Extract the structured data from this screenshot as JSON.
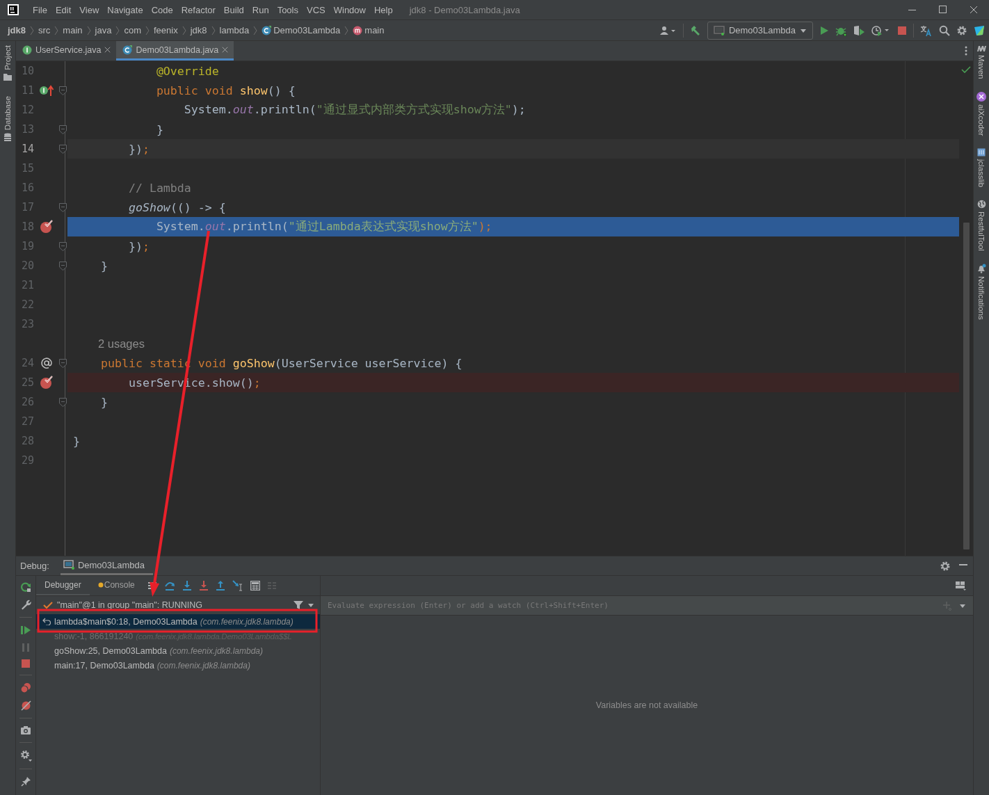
{
  "window": {
    "title": "jdk8 - Demo03Lambda.java"
  },
  "menu": [
    "File",
    "Edit",
    "View",
    "Navigate",
    "Code",
    "Refactor",
    "Build",
    "Run",
    "Tools",
    "VCS",
    "Window",
    "Help"
  ],
  "breadcrumbs": [
    {
      "label": "jdk8",
      "kind": "project"
    },
    {
      "label": "src",
      "kind": "folder"
    },
    {
      "label": "main",
      "kind": "folder"
    },
    {
      "label": "java",
      "kind": "folder"
    },
    {
      "label": "com",
      "kind": "folder"
    },
    {
      "label": "feenix",
      "kind": "folder"
    },
    {
      "label": "jdk8",
      "kind": "folder"
    },
    {
      "label": "lambda",
      "kind": "folder"
    },
    {
      "label": "Demo03Lambda",
      "kind": "class"
    },
    {
      "label": "main",
      "kind": "method"
    }
  ],
  "run_config": {
    "label": "Demo03Lambda"
  },
  "editor_tabs": [
    {
      "label": "UserService.java",
      "kind": "interface",
      "selected": false
    },
    {
      "label": "Demo03Lambda.java",
      "kind": "class",
      "selected": true
    }
  ],
  "left_tool_windows": [
    "Project",
    "Database"
  ],
  "right_tool_windows": [
    "Maven",
    "aiXcoder",
    "jclasslib",
    "RestfulTool",
    "Notifications"
  ],
  "code_lines": [
    {
      "kind": "code",
      "number": "10",
      "tokens": [
        {
          "t": "            @Override",
          "kind": "annotation"
        }
      ]
    },
    {
      "kind": "code",
      "number": "11",
      "marker": {
        "kind": "implements"
      },
      "fold": true,
      "tokens": [
        {
          "t": "            public void ",
          "kind": "keyword"
        },
        {
          "t": "show",
          "kind": "decl"
        },
        {
          "t": "() {",
          "kind": "plain"
        }
      ]
    },
    {
      "kind": "code",
      "number": "12",
      "tokens": [
        {
          "t": "                System.",
          "kind": "plain"
        },
        {
          "t": "out",
          "kind": "field"
        },
        {
          "t": ".println(",
          "kind": "plain"
        },
        {
          "t": "\"通过显式内部类方式实现show方法\"",
          "kind": "string"
        },
        {
          "t": ");",
          "kind": "plain"
        }
      ]
    },
    {
      "kind": "code",
      "number": "13",
      "fold": true,
      "tokens": [
        {
          "t": "            }",
          "kind": "plain"
        }
      ]
    },
    {
      "kind": "code",
      "number": "14",
      "fold": true,
      "highlight": {
        "kind": "caret"
      },
      "tokens": [
        {
          "t": "        })",
          "kind": "plain"
        },
        {
          "t": ";",
          "kind": "keyword"
        }
      ]
    },
    {
      "kind": "code",
      "number": "15"
    },
    {
      "kind": "code",
      "number": "16",
      "tokens": [
        {
          "t": "        // Lambda",
          "kind": "comment"
        }
      ]
    },
    {
      "kind": "code",
      "number": "17",
      "fold": true,
      "tokens": [
        {
          "t": "        goShow",
          "kind": "call"
        },
        {
          "t": "(() -> {",
          "kind": "plain"
        }
      ]
    },
    {
      "kind": "code",
      "number": "18",
      "marker": {
        "kind": "breakpoint"
      },
      "highlight": {
        "kind": "execution"
      },
      "tokens": [
        {
          "t": "            System.",
          "kind": "plain"
        },
        {
          "t": "out",
          "kind": "field"
        },
        {
          "t": ".println(",
          "kind": "plain"
        },
        {
          "t": "\"通过Lambda表达式实现show方法\"",
          "kind": "string"
        },
        {
          "t": ");",
          "kind": "keyword"
        }
      ]
    },
    {
      "kind": "code",
      "number": "19",
      "fold": true,
      "tokens": [
        {
          "t": "        })",
          "kind": "plain"
        },
        {
          "t": ";",
          "kind": "keyword"
        }
      ]
    },
    {
      "kind": "code",
      "number": "20",
      "fold": true,
      "tokens": [
        {
          "t": "    }",
          "kind": "plain"
        }
      ]
    },
    {
      "kind": "code",
      "number": "21"
    },
    {
      "kind": "code",
      "number": "22"
    },
    {
      "kind": "code",
      "number": "23"
    },
    {
      "kind": "inlay",
      "text": "2 usages"
    },
    {
      "kind": "code",
      "number": "24",
      "marker": {
        "kind": "override"
      },
      "fold": true,
      "tokens": [
        {
          "t": "    public static void ",
          "kind": "keyword"
        },
        {
          "t": "goShow",
          "kind": "decl"
        },
        {
          "t": "(UserService userService) {",
          "kind": "plain"
        }
      ]
    },
    {
      "kind": "code",
      "number": "25",
      "marker": {
        "kind": "breakpoint"
      },
      "highlight": {
        "kind": "breakpoint"
      },
      "tokens": [
        {
          "t": "        userService.show()",
          "kind": "plain"
        },
        {
          "t": ";",
          "kind": "keyword"
        }
      ]
    },
    {
      "kind": "code",
      "number": "26",
      "fold": true,
      "tokens": [
        {
          "t": "    }",
          "kind": "plain"
        }
      ]
    },
    {
      "kind": "code",
      "number": "27"
    },
    {
      "kind": "code",
      "number": "28",
      "tokens": [
        {
          "t": "}",
          "kind": "plain"
        }
      ]
    },
    {
      "kind": "code",
      "number": "29"
    }
  ],
  "debug": {
    "label": "Debug:",
    "session_tab": "Demo03Lambda",
    "tabs": [
      {
        "label": "Debugger",
        "selected": true
      },
      {
        "label": "Console",
        "selected": false
      }
    ],
    "thread": "\"main\"@1 in group \"main\": RUNNING",
    "frames": [
      {
        "location": "lambda$main$0:18, Demo03Lambda",
        "package": "(com.feenix.jdk8.lambda)",
        "kind": "current",
        "selected": true
      },
      {
        "location": "show:-1, 866191240",
        "package": "(com.feenix.jdk8.lambda.Demo03Lambda$$L",
        "kind": "hidden",
        "selected": false
      },
      {
        "location": "goShow:25, Demo03Lambda",
        "package": "(com.feenix.jdk8.lambda)",
        "kind": "normal",
        "selected": false
      },
      {
        "location": "main:17, Demo03Lambda",
        "package": "(com.feenix.jdk8.lambda)",
        "kind": "normal",
        "selected": false
      }
    ],
    "watch": {
      "placeholder": "Evaluate expression (Enter) or add a watch (Ctrl+Shift+Enter)"
    },
    "variables_message": "Variables are not available"
  }
}
